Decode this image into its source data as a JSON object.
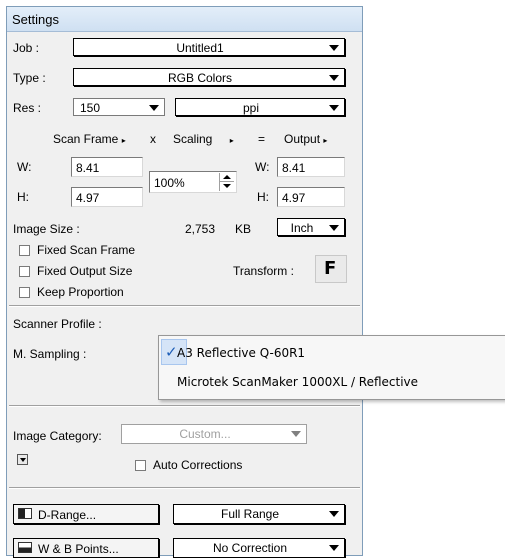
{
  "window": {
    "title": "Settings"
  },
  "job": {
    "label": "Job :",
    "value": "Untitled1"
  },
  "type": {
    "label": "Type :",
    "value": "RGB Colors"
  },
  "res": {
    "label": "Res :",
    "value": "150",
    "unit": "ppi"
  },
  "header": {
    "scan_frame": "Scan Frame",
    "x": "x",
    "scaling": "Scaling",
    "eq": "=",
    "output": "Output"
  },
  "scan": {
    "w_label": "W:",
    "w": "8.41",
    "h_label": "H:",
    "h": "4.97"
  },
  "scaling": {
    "value": "100%"
  },
  "output": {
    "w_label": "W:",
    "w": "8.41",
    "h_label": "H:",
    "h": "4.97"
  },
  "image_size": {
    "label": "Image Size :",
    "value": "2,753",
    "unit": "KB",
    "unit_select": "Inch"
  },
  "options": {
    "fixed_scan_frame": "Fixed Scan Frame",
    "fixed_output_size": "Fixed Output Size",
    "keep_proportion": "Keep Proportion"
  },
  "transform": {
    "label": "Transform :",
    "icon_text": "F"
  },
  "scanner_profile": {
    "label": "Scanner Profile :"
  },
  "m_sampling": {
    "label": "M. Sampling :"
  },
  "profile_menu": {
    "items": [
      {
        "label": "A3 Reflective Q-60R1",
        "selected": true
      },
      {
        "label": "Microtek ScanMaker 1000XL / Reflective",
        "selected": false
      }
    ]
  },
  "image_category": {
    "label": "Image Category:",
    "value": "Custom..."
  },
  "auto_corrections": {
    "label": "Auto Corrections"
  },
  "d_range": {
    "button": "D-Range...",
    "value": "Full Range"
  },
  "wb_points": {
    "button": "W & B Points...",
    "value": "No Correction"
  }
}
